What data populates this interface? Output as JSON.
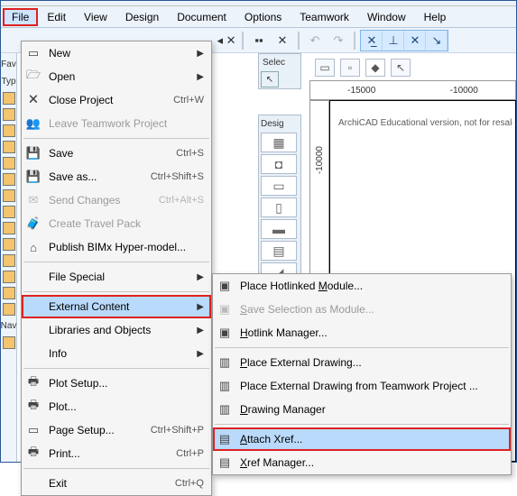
{
  "menubar": [
    "File",
    "Edit",
    "View",
    "Design",
    "Document",
    "Options",
    "Teamwork",
    "Window",
    "Help"
  ],
  "rail": {
    "fav": "Fav",
    "typ": "Typ",
    "nav": "Nav"
  },
  "file_menu": [
    {
      "icon": "▭",
      "label": "New",
      "shortcut": "",
      "arrow": true,
      "disabled": false
    },
    {
      "icon": "🗁",
      "label": "Open",
      "shortcut": "",
      "arrow": true,
      "disabled": false
    },
    {
      "icon": "🗙",
      "label": "Close Project",
      "shortcut": "Ctrl+W",
      "arrow": false,
      "disabled": false
    },
    {
      "icon": "👥",
      "label": "Leave Teamwork Project",
      "shortcut": "",
      "arrow": false,
      "disabled": true
    },
    {
      "sep": true
    },
    {
      "icon": "💾",
      "label": "Save",
      "shortcut": "Ctrl+S",
      "arrow": false,
      "disabled": false
    },
    {
      "icon": "💾",
      "label": "Save as...",
      "shortcut": "Ctrl+Shift+S",
      "arrow": false,
      "disabled": false
    },
    {
      "icon": "✉",
      "label": "Send Changes",
      "shortcut": "Ctrl+Alt+S",
      "arrow": false,
      "disabled": true
    },
    {
      "icon": "🧳",
      "label": "Create Travel Pack",
      "shortcut": "",
      "arrow": false,
      "disabled": true
    },
    {
      "icon": "⌂",
      "label": "Publish BIMx Hyper-model...",
      "shortcut": "",
      "arrow": false,
      "disabled": false
    },
    {
      "sep": true
    },
    {
      "icon": "",
      "label": "File Special",
      "shortcut": "",
      "arrow": true,
      "disabled": false
    },
    {
      "sep": true
    },
    {
      "icon": "",
      "label": "External Content",
      "shortcut": "",
      "arrow": true,
      "disabled": false,
      "hl": true
    },
    {
      "icon": "",
      "label": "Libraries and Objects",
      "shortcut": "",
      "arrow": true,
      "disabled": false
    },
    {
      "icon": "",
      "label": "Info",
      "shortcut": "",
      "arrow": true,
      "disabled": false
    },
    {
      "sep": true
    },
    {
      "icon": "🖶",
      "label": "Plot Setup...",
      "shortcut": "",
      "arrow": false,
      "disabled": false
    },
    {
      "icon": "🖶",
      "label": "Plot...",
      "shortcut": "",
      "arrow": false,
      "disabled": false
    },
    {
      "icon": "▭",
      "label": "Page Setup...",
      "shortcut": "Ctrl+Shift+P",
      "arrow": false,
      "disabled": false
    },
    {
      "icon": "🖶",
      "label": "Print...",
      "shortcut": "Ctrl+P",
      "arrow": false,
      "disabled": false
    },
    {
      "sep": true
    },
    {
      "icon": "",
      "label": "Exit",
      "shortcut": "Ctrl+Q",
      "arrow": false,
      "disabled": false
    }
  ],
  "ext_menu": [
    {
      "icon": "▣",
      "label": "Place Hotlinked Module...",
      "u": "M",
      "disabled": false
    },
    {
      "icon": "▣",
      "label": "Save Selection as Module...",
      "u": "S",
      "disabled": true
    },
    {
      "icon": "▣",
      "label": "Hotlink Manager...",
      "u": "H",
      "disabled": false
    },
    {
      "sep": true
    },
    {
      "icon": "▥",
      "label": "Place External Drawing...",
      "u": "P",
      "disabled": false
    },
    {
      "icon": "▥",
      "label": "Place External Drawing from Teamwork Project ...",
      "disabled": false
    },
    {
      "icon": "▥",
      "label": "Drawing Manager",
      "u": "D",
      "disabled": false
    },
    {
      "sep": true
    },
    {
      "icon": "▤",
      "label": "Attach Xref...",
      "u": "A",
      "disabled": false,
      "hl": true
    },
    {
      "icon": "▤",
      "label": "Xref Manager...",
      "u": "X",
      "disabled": false
    }
  ],
  "ruler": {
    "l": "-15000",
    "r": "-10000"
  },
  "vruler": {
    "a": "-10000"
  },
  "watermark": "ArchiCAD Educational version, not for resale. Cou",
  "panels": {
    "select": "Selec",
    "design": "Desig"
  }
}
